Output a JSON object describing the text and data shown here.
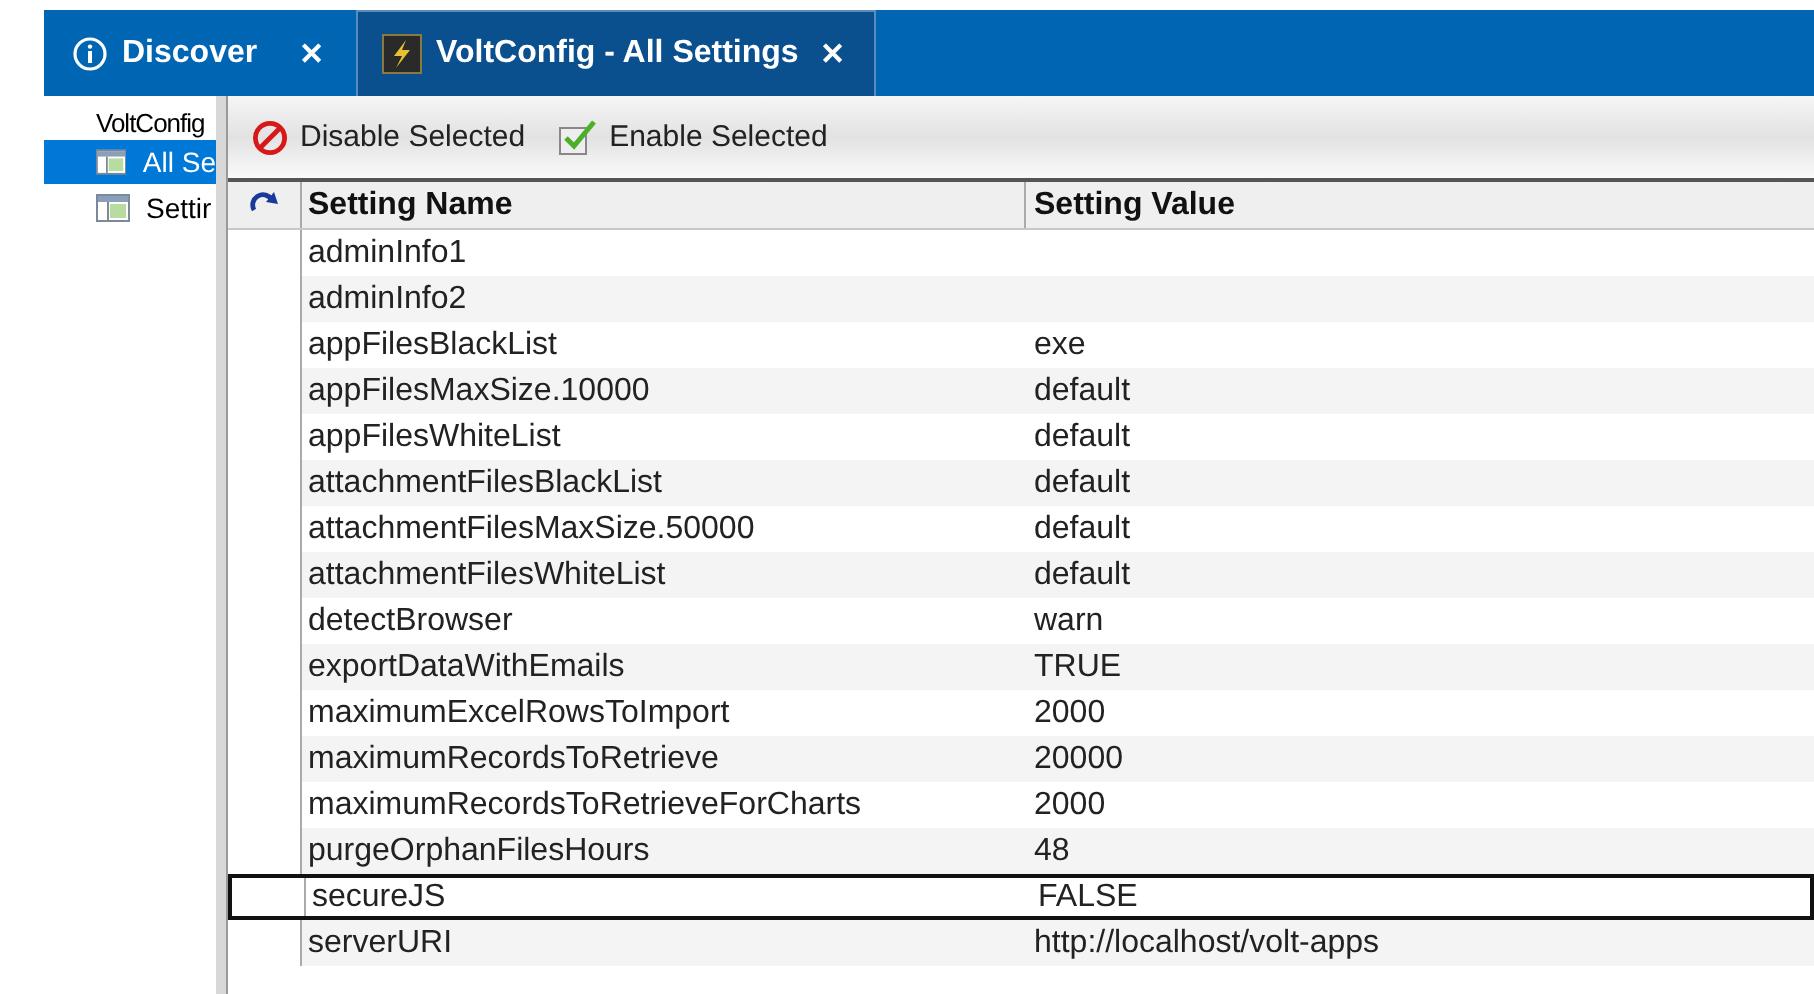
{
  "tabs": [
    {
      "kind": "info",
      "label": "Discover",
      "close": "✕",
      "selected": false
    },
    {
      "kind": "app",
      "label": "VoltConfig - All Settings",
      "close": "✕",
      "selected": true
    }
  ],
  "sidebar": {
    "title": "VoltConfig",
    "items": [
      {
        "label": "All Se",
        "selected": true
      },
      {
        "label": "Settir",
        "selected": false
      }
    ]
  },
  "toolbar": [
    {
      "kind": "disable",
      "label": "Disable Selected"
    },
    {
      "kind": "enable",
      "label": "Enable Selected"
    }
  ],
  "table": {
    "columns": [
      "Setting Name",
      "Setting Value"
    ],
    "rows": [
      {
        "name": "adminInfo1",
        "value": "",
        "selected": false
      },
      {
        "name": "adminInfo2",
        "value": "",
        "selected": false
      },
      {
        "name": "appFilesBlackList",
        "value": "exe",
        "selected": false
      },
      {
        "name": "appFilesMaxSize.10000",
        "value": "default",
        "selected": false
      },
      {
        "name": "appFilesWhiteList",
        "value": "default",
        "selected": false
      },
      {
        "name": "attachmentFilesBlackList",
        "value": "default",
        "selected": false
      },
      {
        "name": "attachmentFilesMaxSize.50000",
        "value": "default",
        "selected": false
      },
      {
        "name": "attachmentFilesWhiteList",
        "value": "default",
        "selected": false
      },
      {
        "name": "detectBrowser",
        "value": "warn",
        "selected": false
      },
      {
        "name": "exportDataWithEmails",
        "value": "TRUE",
        "selected": false
      },
      {
        "name": "maximumExcelRowsToImport",
        "value": "2000",
        "selected": false
      },
      {
        "name": "maximumRecordsToRetrieve",
        "value": "20000",
        "selected": false
      },
      {
        "name": "maximumRecordsToRetrieveForCharts",
        "value": "2000",
        "selected": false
      },
      {
        "name": "purgeOrphanFilesHours",
        "value": "48",
        "selected": false
      },
      {
        "name": "secureJS",
        "value": "FALSE",
        "selected": true
      },
      {
        "name": "serverURI",
        "value": "http://localhost/volt-apps",
        "selected": false
      }
    ]
  }
}
